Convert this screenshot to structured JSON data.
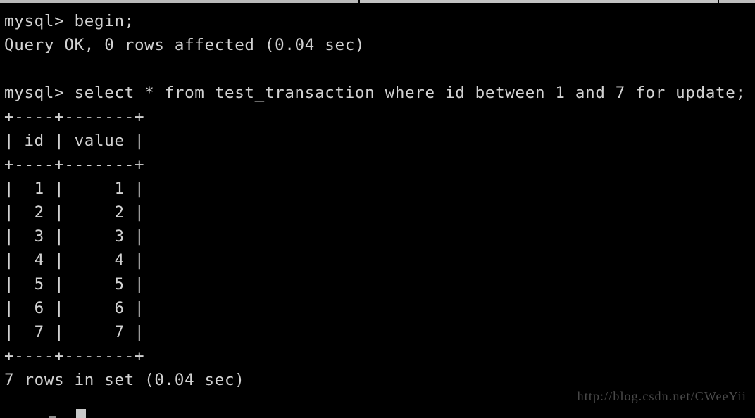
{
  "terminal": {
    "background_color": "#000000",
    "text_color": "#d2d2d2",
    "lines": [
      "mysql> begin;",
      "Query OK, 0 rows affected (0.04 sec)",
      "",
      "mysql> select * from test_transaction where id between 1 and 7 for update;",
      "+----+-------+",
      "| id | value |",
      "+----+-------+",
      "|  1 |     1 |",
      "|  2 |     2 |",
      "|  3 |     3 |",
      "|  4 |     4 |",
      "|  5 |     5 |",
      "|  6 |     6 |",
      "|  7 |     7 |",
      "+----+-------+",
      "7 rows in set (0.04 sec)"
    ],
    "commands": [
      {
        "prompt": "mysql>",
        "text": "begin;"
      },
      {
        "prompt": "mysql>",
        "text": "select * from test_transaction where id between 1 and 7 for update;"
      }
    ],
    "results": [
      {
        "message": "Query OK, 0 rows affected (0.04 sec)",
        "rows_affected": 0,
        "duration_sec": "0.04"
      },
      {
        "message": "7 rows in set (0.04 sec)",
        "row_count": 7,
        "duration_sec": "0.04"
      }
    ],
    "result_table": {
      "columns": [
        "id",
        "value"
      ],
      "rows": [
        [
          "1",
          "1"
        ],
        [
          "2",
          "2"
        ],
        [
          "3",
          "3"
        ],
        [
          "4",
          "4"
        ],
        [
          "5",
          "5"
        ],
        [
          "6",
          "6"
        ],
        [
          "7",
          "7"
        ]
      ],
      "separator": "+----+-------+",
      "header_row": "| id | value |"
    },
    "cursor": {
      "visible": true,
      "style": "block"
    }
  },
  "watermark": {
    "text": "http://blog.csdn.net/CWeeYii",
    "color": "#4a4a4a"
  },
  "window_chrome": {
    "strip_color": "#b9b9b9"
  }
}
